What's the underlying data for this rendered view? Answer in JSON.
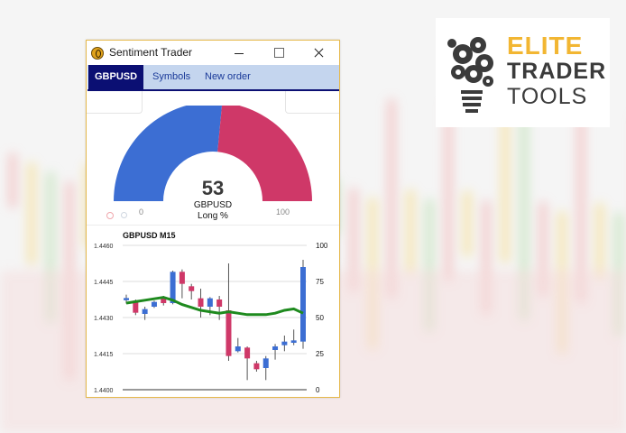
{
  "window": {
    "title": "Sentiment Trader"
  },
  "tabs": [
    {
      "label": "GBPUSD",
      "active": true
    },
    {
      "label": "Symbols",
      "active": false
    },
    {
      "label": "New order",
      "active": false
    }
  ],
  "gauge": {
    "value": "53",
    "percent": 53,
    "symbol": "GBPUSD",
    "label": "Long %",
    "min": "0",
    "max": "100",
    "colors": {
      "long": "#3c6ed3",
      "short": "#cf3868"
    }
  },
  "chart": {
    "title": "GBPUSD M15",
    "left_ticks": [
      "1.4460",
      "1.4445",
      "1.4430",
      "1.4415",
      "1.4400"
    ],
    "right_ticks": [
      "100",
      "75",
      "50",
      "25",
      "0"
    ],
    "candles": [
      {
        "o": 1.44372,
        "c": 1.44381,
        "h": 1.44395,
        "l": 1.44358
      },
      {
        "o": 1.4437,
        "c": 1.4432,
        "h": 1.44375,
        "l": 1.4431
      },
      {
        "o": 1.44315,
        "c": 1.44335,
        "h": 1.44345,
        "l": 1.4429
      },
      {
        "o": 1.44345,
        "c": 1.44365,
        "h": 1.4437,
        "l": 1.4434
      },
      {
        "o": 1.4438,
        "c": 1.4436,
        "h": 1.4439,
        "l": 1.4435
      },
      {
        "o": 1.4436,
        "c": 1.4449,
        "h": 1.44495,
        "l": 1.44355
      },
      {
        "o": 1.4449,
        "c": 1.4444,
        "h": 1.445,
        "l": 1.4438
      },
      {
        "o": 1.4443,
        "c": 1.4441,
        "h": 1.4444,
        "l": 1.44375
      },
      {
        "o": 1.4438,
        "c": 1.44345,
        "h": 1.4442,
        "l": 1.443
      },
      {
        "o": 1.44345,
        "c": 1.4438,
        "h": 1.44385,
        "l": 1.4431
      },
      {
        "o": 1.44375,
        "c": 1.44345,
        "h": 1.4439,
        "l": 1.4429
      },
      {
        "o": 1.4433,
        "c": 1.4414,
        "h": 1.44525,
        "l": 1.4412
      },
      {
        "o": 1.4416,
        "c": 1.4418,
        "h": 1.44215,
        "l": 1.44155
      },
      {
        "o": 1.44175,
        "c": 1.4413,
        "h": 1.4418,
        "l": 1.4404
      },
      {
        "o": 1.4411,
        "c": 1.44085,
        "h": 1.4412,
        "l": 1.44075
      },
      {
        "o": 1.4409,
        "c": 1.4413,
        "h": 1.4414,
        "l": 1.4404
      },
      {
        "o": 1.44165,
        "c": 1.4418,
        "h": 1.4419,
        "l": 1.44125
      },
      {
        "o": 1.44185,
        "c": 1.442,
        "h": 1.44225,
        "l": 1.4416
      },
      {
        "o": 1.44195,
        "c": 1.44205,
        "h": 1.4425,
        "l": 1.44185
      },
      {
        "o": 1.442,
        "c": 1.4451,
        "h": 1.4454,
        "l": 1.4417
      }
    ],
    "sentiment_line": [
      60,
      61,
      62,
      63,
      64,
      62,
      59,
      57,
      55,
      54,
      53,
      54,
      53,
      52,
      52,
      52,
      53,
      55,
      56,
      53
    ]
  },
  "logo": {
    "line1": "ELITE",
    "line2": "TRADER",
    "line3": "TOOLS",
    "accent": "#f2b632"
  }
}
